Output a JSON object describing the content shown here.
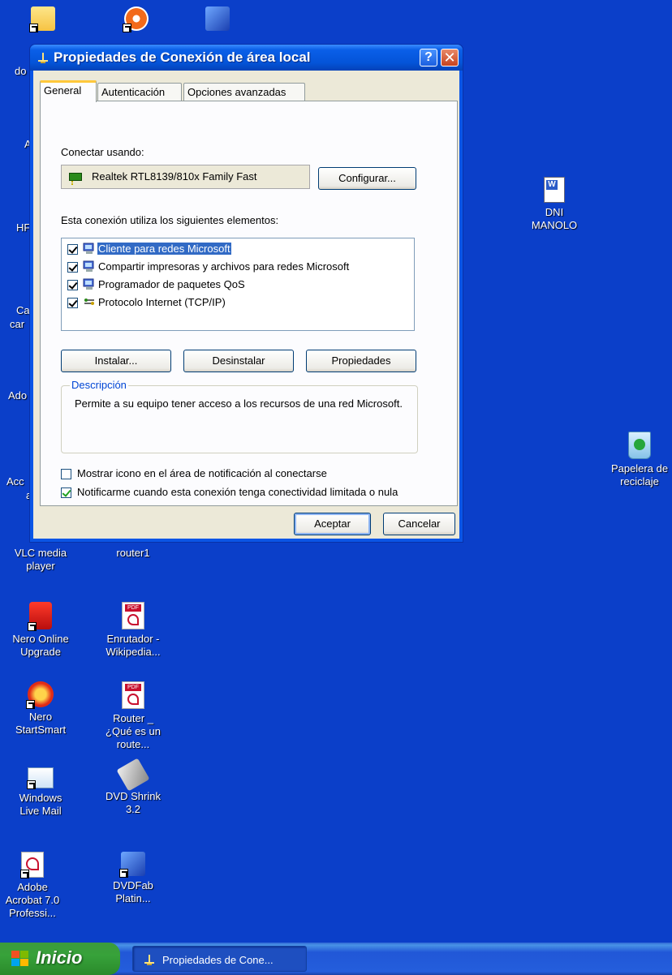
{
  "window": {
    "title": "Propiedades de Conexión de área local",
    "help_label": "?",
    "close_label": "✕"
  },
  "tabs": [
    {
      "label": "General",
      "active": true
    },
    {
      "label": "Autenticación",
      "active": false
    },
    {
      "label": "Opciones avanzadas",
      "active": false
    }
  ],
  "general": {
    "connect_using_label": "Conectar usando:",
    "adapter_name": "Realtek RTL8139/810x Family Fast",
    "configure_label": "Configurar...",
    "items_label": "Esta conexión utiliza los siguientes elementos:",
    "items": [
      {
        "label": "Cliente para redes Microsoft",
        "checked": true,
        "selected": true,
        "icon": "network-client-icon"
      },
      {
        "label": "Compartir impresoras y archivos para redes Microsoft",
        "checked": true,
        "selected": false,
        "icon": "network-service-icon"
      },
      {
        "label": "Programador de paquetes QoS",
        "checked": true,
        "selected": false,
        "icon": "network-service-icon"
      },
      {
        "label": "Protocolo Internet (TCP/IP)",
        "checked": true,
        "selected": false,
        "icon": "protocol-icon"
      }
    ],
    "install_label": "Instalar...",
    "uninstall_label": "Desinstalar",
    "properties_label": "Propiedades",
    "description_legend": "Descripción",
    "description_text": "Permite a su equipo tener acceso a los recursos de una red Microsoft.",
    "show_icon_label": "Mostrar icono en el área de notificación al conectarse",
    "show_icon_checked": false,
    "notify_label": "Notificarme cuando esta conexión tenga conectividad limitada o nula",
    "notify_checked": true
  },
  "footer": {
    "ok_label": "Aceptar",
    "cancel_label": "Cancelar"
  },
  "desktop": {
    "icons": {
      "dni": "DNI MANOLO",
      "recycle": "Papelera de reciclaje",
      "vlc": "VLC media player",
      "router1": "router1",
      "nero_online": "Nero Online Upgrade",
      "enrutador": "Enrutador - Wikipedia...",
      "nero_start": "Nero StartSmart",
      "router_que": "Router _ ¿Qué es un route...",
      "wlm": "Windows Live Mail",
      "dvdshrink": "DVD Shrink 3.2",
      "acrobat": "Adobe Acrobat 7.0 Professi...",
      "dvdfab": "DVDFab Platin..."
    },
    "edge_labels": [
      "do",
      "A",
      "HF",
      "Ca",
      "car",
      "Ado",
      "Acc",
      "a"
    ]
  },
  "taskbar": {
    "start_label": "Inicio",
    "task_label": "Propiedades de Cone..."
  },
  "colors": {
    "desktop_bg": "#0b3fc9",
    "selection": "#316ac5",
    "start_green": "#37a23a"
  }
}
